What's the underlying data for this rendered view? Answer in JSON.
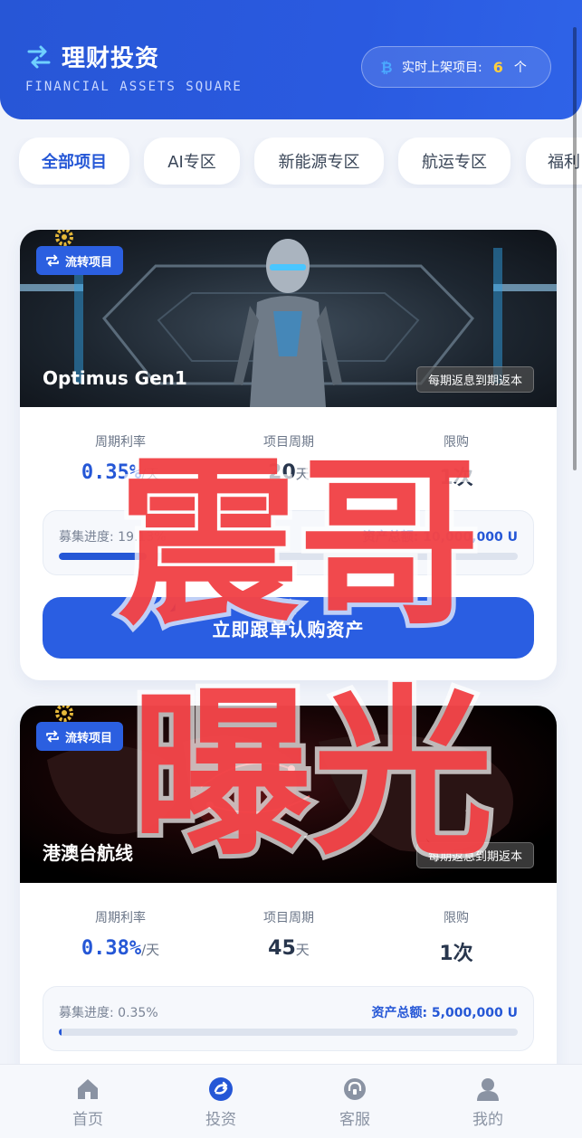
{
  "header": {
    "title": "理财投资",
    "subtitle": "FINANCIAL ASSETS SQUARE",
    "live_label": "实时上架项目:",
    "live_count": "6",
    "live_unit": "个",
    "brand_icon": "swap-arrows-icon",
    "live_icon": "bitcoin-icon"
  },
  "tabs": [
    {
      "label": "全部项目",
      "active": true
    },
    {
      "label": "AI专区",
      "active": false
    },
    {
      "label": "新能源专区",
      "active": false
    },
    {
      "label": "航运专区",
      "active": false
    },
    {
      "label": "福利",
      "active": false
    }
  ],
  "cards": [
    {
      "title": "Optimus Gen1",
      "badge": "流转项目",
      "return_type": "每期返息到期返本",
      "rate_label": "周期利率",
      "rate_value": "0.35%",
      "rate_unit": "/天",
      "period_label": "项目周期",
      "period_value": "20",
      "period_unit": "天",
      "limit_label": "限购",
      "limit_value": "1次",
      "progress_label": "募集进度: 19.13%",
      "progress": 0.1913,
      "total_label": "资产总额: 10,000,000 U",
      "cta": "立即跟单认购资产",
      "image": "humanoid-robot-image"
    },
    {
      "title": "港澳台航线",
      "badge": "流转项目",
      "return_type": "每期返息到期返本",
      "rate_label": "周期利率",
      "rate_value": "0.38%",
      "rate_unit": "/天",
      "period_label": "项目周期",
      "period_value": "45",
      "period_unit": "天",
      "limit_label": "限购",
      "limit_value": "1次",
      "progress_label": "募集进度: 0.35%",
      "progress": 0.0035,
      "total_label": "资产总额: 5,000,000 U",
      "image": "route-map-image"
    }
  ],
  "watermark": {
    "line1": "震哥",
    "line2": "曝光",
    "color": "#f03a3e"
  },
  "nav": [
    {
      "label": "首页",
      "icon": "home-icon",
      "active": false
    },
    {
      "label": "投资",
      "icon": "invest-icon",
      "active": true
    },
    {
      "label": "客服",
      "icon": "support-icon",
      "active": false
    },
    {
      "label": "我的",
      "icon": "user-icon",
      "active": false
    }
  ],
  "colors": {
    "primary": "#2557d6",
    "accent": "#ffcf3f"
  }
}
